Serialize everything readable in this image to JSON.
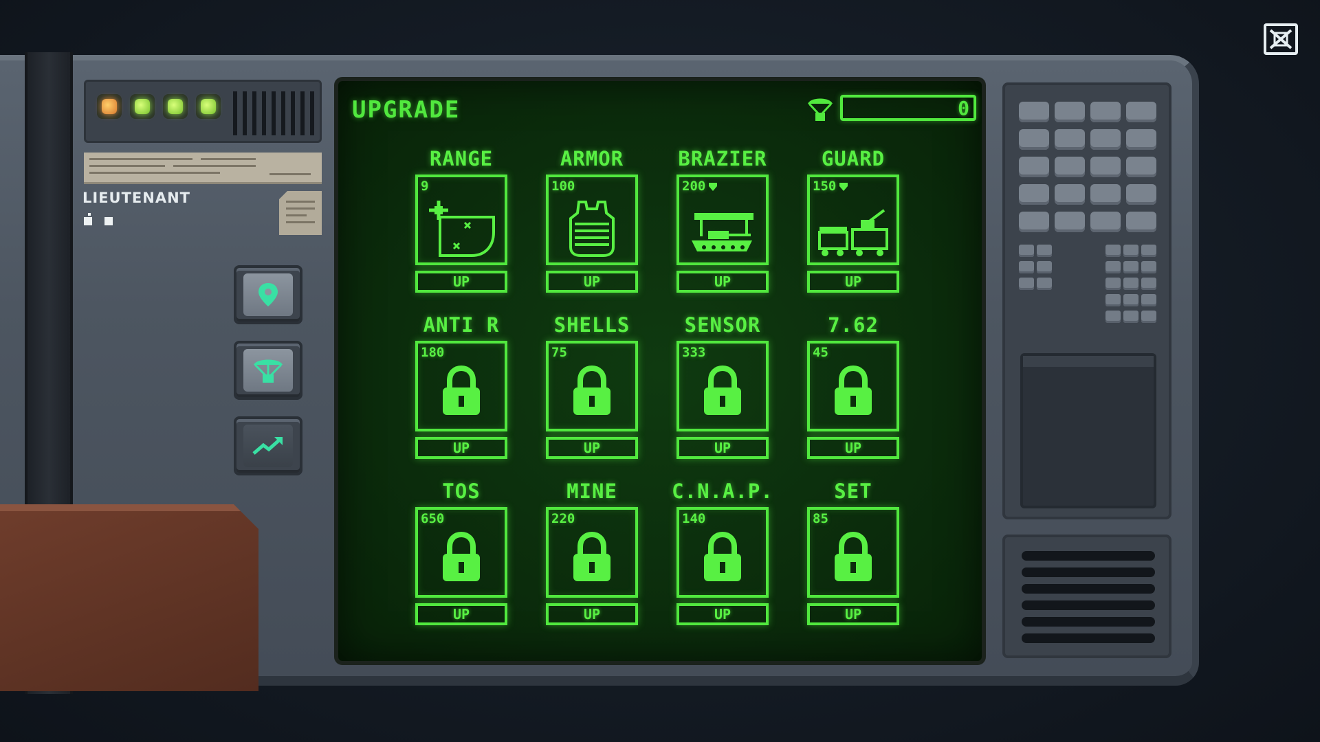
{
  "window": {
    "close_icon": "close-x-icon"
  },
  "left_panel": {
    "status_leds": [
      "orange",
      "green",
      "green",
      "green"
    ],
    "rank_label": "LIEUTENANT",
    "buttons": [
      {
        "icon": "map-pin-icon"
      },
      {
        "icon": "airdrop-icon"
      },
      {
        "icon": "trend-up-icon"
      }
    ]
  },
  "screen": {
    "title": "UPGRADE",
    "resource_icon": "airdrop-icon",
    "resource_value": "0",
    "resource_progress": 0
  },
  "upgrades": [
    {
      "name": "RANGE",
      "cost": "9",
      "locked": false,
      "icon": "range-target-icon",
      "button": "UP"
    },
    {
      "name": "ARMOR",
      "cost": "100",
      "locked": false,
      "icon": "armor-vest-icon",
      "button": "UP"
    },
    {
      "name": "BRAZIER",
      "cost": "200",
      "locked": false,
      "icon": "tank-brazier-icon",
      "button": "UP"
    },
    {
      "name": "GUARD",
      "cost": "150",
      "locked": false,
      "icon": "guard-train-icon",
      "button": "UP"
    },
    {
      "name": "ANTI R",
      "cost": "180",
      "locked": true,
      "icon": "lock-icon",
      "button": "UP"
    },
    {
      "name": "SHELLS",
      "cost": "75",
      "locked": true,
      "icon": "lock-icon",
      "button": "UP"
    },
    {
      "name": "SENSOR",
      "cost": "333",
      "locked": true,
      "icon": "lock-icon",
      "button": "UP"
    },
    {
      "name": "7.62",
      "cost": "45",
      "locked": true,
      "icon": "lock-icon",
      "button": "UP"
    },
    {
      "name": "TOS",
      "cost": "650",
      "locked": true,
      "icon": "lock-icon",
      "button": "UP"
    },
    {
      "name": "MINE",
      "cost": "220",
      "locked": true,
      "icon": "lock-icon",
      "button": "UP"
    },
    {
      "name": "C.N.A.P.",
      "cost": "140",
      "locked": true,
      "icon": "lock-icon",
      "button": "UP"
    },
    {
      "name": "SET",
      "cost": "85",
      "locked": true,
      "icon": "lock-icon",
      "button": "UP"
    }
  ],
  "colors": {
    "screen_green": "#51e83e",
    "screen_bg": "#0b2c0c",
    "panel_gray": "#4d5661",
    "led_orange": "#d8792f",
    "led_green": "#79c22f"
  }
}
